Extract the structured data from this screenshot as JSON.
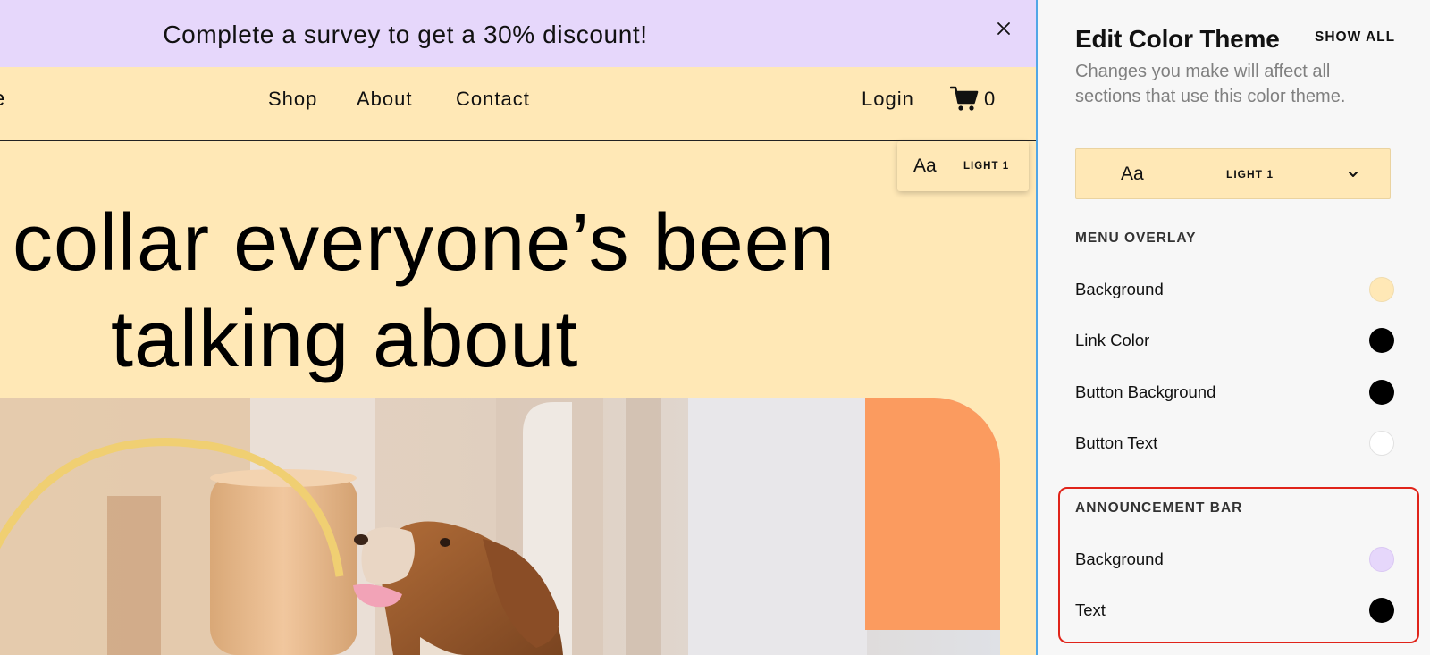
{
  "announcement": {
    "text": "Complete a survey to get a 30% discount!",
    "close_icon": "close-icon"
  },
  "header": {
    "logo_fragment": "e",
    "nav": [
      "Shop",
      "About",
      "Contact"
    ],
    "login": "Login",
    "cart_icon": "shopping-cart-icon",
    "cart_count": "0"
  },
  "theme_chip": {
    "sample": "Aa",
    "name": "LIGHT 1"
  },
  "hero": {
    "line1": "collar everyone’s been",
    "line2": "talking about"
  },
  "panel": {
    "title": "Edit Color Theme",
    "show_all": "SHOW ALL",
    "description": "Changes you make will affect all sections that use this color theme.",
    "theme_select": {
      "sample": "Aa",
      "name": "LIGHT 1",
      "chevron_icon": "chevron-down-icon"
    },
    "menu_overlay": {
      "heading": "MENU OVERLAY",
      "rows": [
        {
          "label": "Background",
          "color": "#ffe8b6"
        },
        {
          "label": "Link Color",
          "color": "#000000"
        },
        {
          "label": "Button Background",
          "color": "#000000"
        },
        {
          "label": "Button Text",
          "color": "#ffffff"
        }
      ]
    },
    "announcement_bar": {
      "heading": "ANNOUNCEMENT BAR",
      "rows": [
        {
          "label": "Background",
          "color": "#e6d7fb"
        },
        {
          "label": "Text",
          "color": "#000000"
        }
      ]
    }
  },
  "colors": {
    "announcement_bg": "#e6d7fb",
    "site_bg": "#ffe8b6",
    "panel_bg": "#f7f7f7",
    "editor_divider": "#52a6e6",
    "highlight_outline": "#e0241a",
    "accent_orange": "#fb9b5f"
  }
}
